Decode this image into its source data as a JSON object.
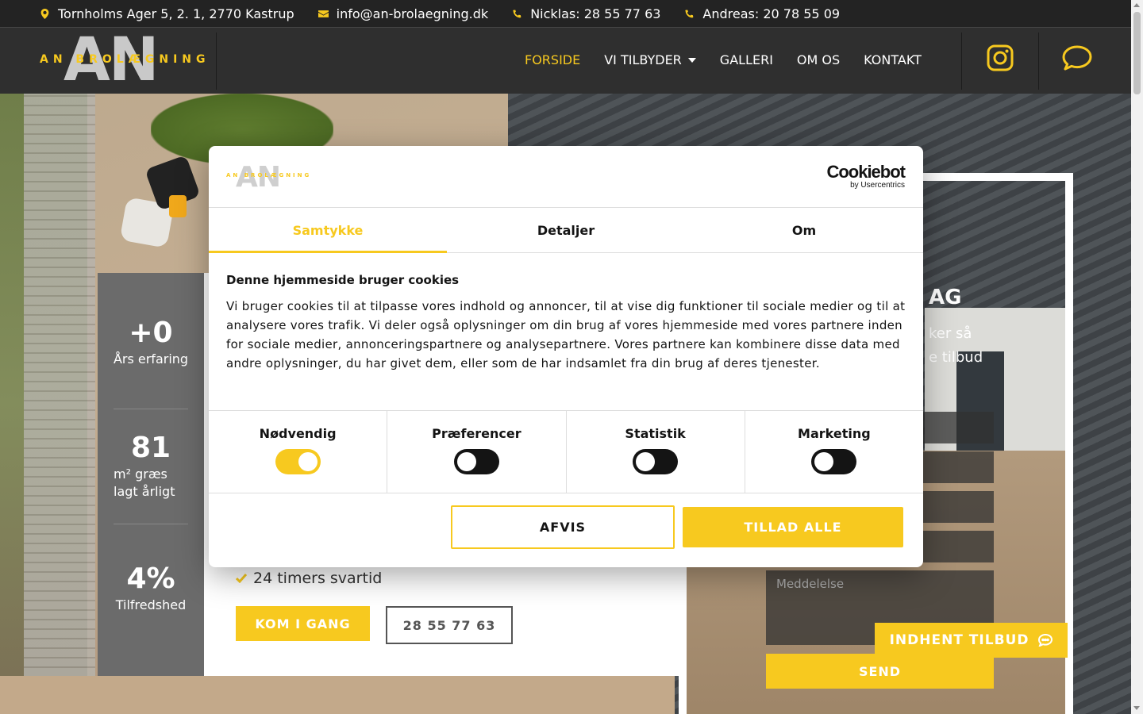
{
  "topbar": {
    "address": "Tornholms Ager 5, 2. 1, 2770 Kastrup",
    "email": "info@an-brolaegning.dk",
    "phone1": "Nicklas: 28 55 77 63",
    "phone2": "Andreas: 20 78 55 09"
  },
  "logo": {
    "letters": "AN",
    "name": "AN BROLÆGNING"
  },
  "nav": {
    "items": [
      {
        "label": "FORSIDE"
      },
      {
        "label": "VI TILBYDER"
      },
      {
        "label": "GALLERI"
      },
      {
        "label": "OM OS"
      },
      {
        "label": "KONTAKT"
      }
    ],
    "icons": [
      "instagram-icon",
      "chat-icon"
    ]
  },
  "stats": [
    {
      "number": "+0",
      "label": "Års erfaring"
    },
    {
      "number": "81",
      "label_line1": "m² græs",
      "label_line2": "lagt årligt"
    },
    {
      "number": "4%",
      "label": "Tilfredshed"
    }
  ],
  "hero": {
    "check_item": "24 timers svartid",
    "cta_primary": "KOM I GANG",
    "cta_phone": "28 55 77 63"
  },
  "form": {
    "heading_partial": "AG",
    "text_line1_partial": "ker så",
    "text_line2_partial": "e tilbud",
    "message_placeholder": "Meddelelse",
    "send_label": "SEND",
    "quote_button": "INDHENT TILBUD"
  },
  "cookie": {
    "brand": "Cookiebot",
    "brand_sub": "by Usercentrics",
    "tabs": [
      {
        "label": "Samtykke",
        "active": true
      },
      {
        "label": "Detaljer",
        "active": false
      },
      {
        "label": "Om",
        "active": false
      }
    ],
    "title": "Denne hjemmeside bruger cookies",
    "body": "Vi bruger cookies til at tilpasse vores indhold og annoncer, til at vise dig funktioner til sociale medier og til at analysere vores trafik. Vi deler også oplysninger om din brug af vores hjemmeside med vores partnere inden for sociale medier, annonceringspartnere og analysepartnere. Vores partnere kan kombinere disse data med andre oplysninger, du har givet dem, eller som de har indsamlet fra din brug af deres tjenester.",
    "toggles": [
      {
        "label": "Nødvendig",
        "on": true
      },
      {
        "label": "Præferencer",
        "on": false
      },
      {
        "label": "Statistik",
        "on": false
      },
      {
        "label": "Marketing",
        "on": false
      }
    ],
    "deny_label": "AFVIS",
    "allow_label": "TILLAD ALLE"
  },
  "colors": {
    "accent": "#f7c91f",
    "dark": "#2f2f2f",
    "topbar": "#232323"
  }
}
